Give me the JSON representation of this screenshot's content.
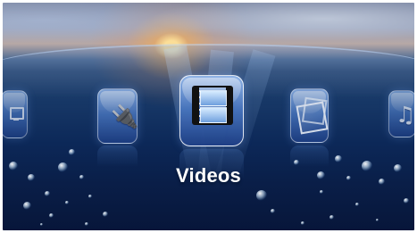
{
  "menu": {
    "selected_label": "Videos",
    "items": [
      {
        "id": "display-settings",
        "icon": "monitor-icon"
      },
      {
        "id": "connections",
        "icon": "plug-icon"
      },
      {
        "id": "videos",
        "icon": "film-icon"
      },
      {
        "id": "photos",
        "icon": "photo-icon"
      },
      {
        "id": "music",
        "icon": "music-note-icon"
      }
    ]
  },
  "icons": {
    "plug_glyph": "🔌",
    "music_glyph": "♫"
  },
  "colors": {
    "sky": "#96a0ba",
    "sunset": "#ffb36b",
    "ocean_deep": "#0a1f49",
    "icon_blue": "#4875be"
  }
}
